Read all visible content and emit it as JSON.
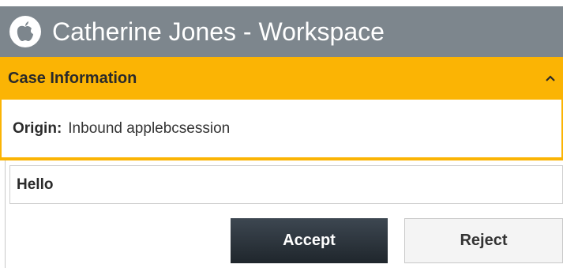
{
  "window": {
    "title": "Catherine Jones - Workspace",
    "icon": "apple-icon"
  },
  "case_info": {
    "header": "Case Information",
    "collapse_icon": "chevron-up-icon",
    "origin_label": "Origin:",
    "origin_value": "Inbound applebcsession"
  },
  "message": {
    "text": "Hello"
  },
  "actions": {
    "accept_label": "Accept",
    "reject_label": "Reject"
  },
  "colors": {
    "title_bar": "#7d868d",
    "accent": "#fbb404",
    "accept_button": "#2b333a",
    "reject_button": "#f4f4f4"
  }
}
